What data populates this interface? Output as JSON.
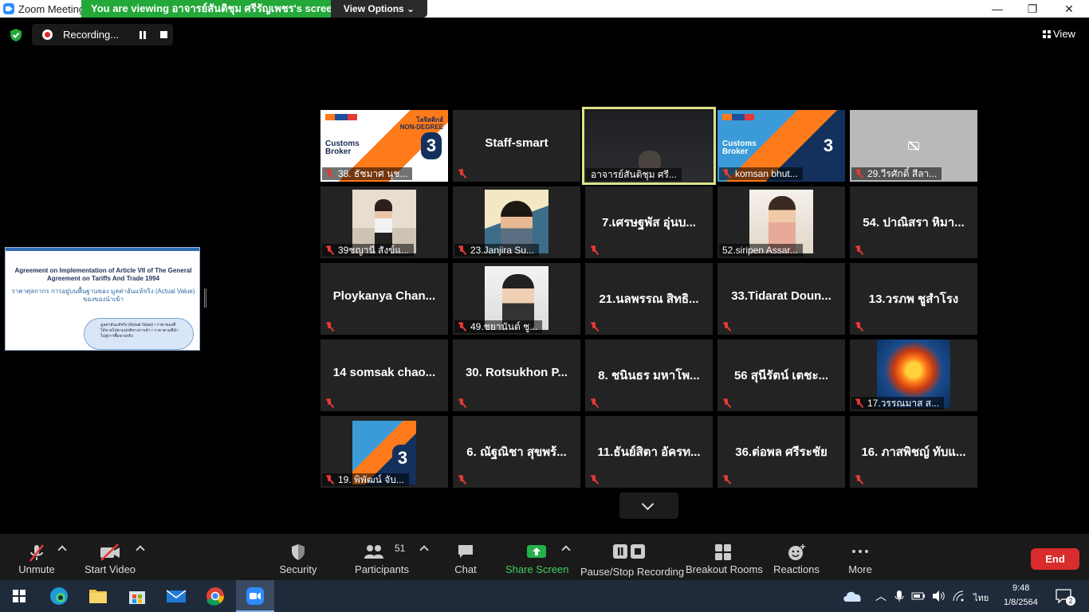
{
  "window": {
    "title": "Zoom Meeting",
    "viewing_banner": "You are viewing อาจารย์สันติชุม ศรีรัญเพชร's screen",
    "view_options_label": "View Options ⌄",
    "minimize": "—",
    "restore": "❐",
    "close": "✕"
  },
  "recording": {
    "label": "Recording..."
  },
  "view_label": "View",
  "shared_screen": {
    "line1": "Agreement on Implementation of Article VII of The General Agreement on Tariffs And Trade 1994",
    "line2": "ราคาศุลกากร การอยู่บนพื้นฐานของ มูลค่าอันแท้จริง (Actual Value) ของของนำเข้า",
    "cloud_text": "มูลค่าอันแท้จริง (Actual Value) • ราคาของที่ได้ขายไปตามปกติทางการค้า • ราคาตามที่นำไปสู่การซื้อขายจริง"
  },
  "poster": {
    "title_line1": "Customs",
    "title_line2": "Broker",
    "number": "3",
    "right_line1": "โลจิสติกส์",
    "right_line2": "NON-DEGREE"
  },
  "tiles": [
    {
      "id": "t1",
      "caption": "38. ธัชมาศ นุช...",
      "name": ""
    },
    {
      "id": "t2",
      "caption": "",
      "name": "Staff-smart"
    },
    {
      "id": "t3",
      "caption": "อาจารย์สันติชุม ศรี...",
      "name": ""
    },
    {
      "id": "t4",
      "caption": "komsan bhut...",
      "name": ""
    },
    {
      "id": "t5",
      "caption": "29.วีรศักดิ์ สีลา...",
      "name": ""
    },
    {
      "id": "t6",
      "caption": "39ชญานี สังข์แ...",
      "name": ""
    },
    {
      "id": "t7",
      "caption": "23.Janjira Su...",
      "name": ""
    },
    {
      "id": "t8",
      "caption": "",
      "name": "7.เศรษฐพัส อุ่นบ..."
    },
    {
      "id": "t9",
      "caption": "52.siripen Assar...",
      "name": ""
    },
    {
      "id": "t10",
      "caption": "",
      "name": "54. ปาณิสรา หิมา..."
    },
    {
      "id": "t11",
      "caption": "",
      "name": "Ploykanya Chan..."
    },
    {
      "id": "t12",
      "caption": "49.ชยานันต์ ชู...",
      "name": ""
    },
    {
      "id": "t13",
      "caption": "",
      "name": "21.นลพรรณ สิทธิ..."
    },
    {
      "id": "t14",
      "caption": "",
      "name": "33.Tidarat Doun..."
    },
    {
      "id": "t15",
      "caption": "",
      "name": "13.วรภพ ชูสำโรง"
    },
    {
      "id": "t16",
      "caption": "",
      "name": "14 somsak chao..."
    },
    {
      "id": "t17",
      "caption": "",
      "name": "30. Rotsukhon P..."
    },
    {
      "id": "t18",
      "caption": "",
      "name": "8. ชนินธร มหาโพ..."
    },
    {
      "id": "t19",
      "caption": "",
      "name": "56 สุนีรัตน์ เตชะ..."
    },
    {
      "id": "t20",
      "caption": "17.วรรณมาส ส...",
      "name": ""
    },
    {
      "id": "t21",
      "caption": "19. พิพัฒน์ จับ...",
      "name": ""
    },
    {
      "id": "t22",
      "caption": "",
      "name": "6. ณัฐณิชา สุขพร้..."
    },
    {
      "id": "t23",
      "caption": "",
      "name": "11.ธันย์สิตา อัครท..."
    },
    {
      "id": "t24",
      "caption": "",
      "name": "36.ต่อพล ศรีระชัย"
    },
    {
      "id": "t25",
      "caption": "",
      "name": "16. ภาสพิชญ์ ทับแ..."
    }
  ],
  "toolbar": {
    "unmute": "Unmute",
    "start_video": "Start Video",
    "security": "Security",
    "participants": "Participants",
    "participants_count": "51",
    "chat": "Chat",
    "share_screen": "Share Screen",
    "pause_stop_recording": "Pause/Stop Recording",
    "breakout_rooms": "Breakout Rooms",
    "reactions": "Reactions",
    "more": "More",
    "end": "End"
  },
  "taskbar": {
    "language": "ไทย",
    "time": "9:48",
    "date": "1/8/2564",
    "notifications": "2"
  },
  "colors": {
    "banner_green": "#23a83a",
    "share_green": "#22b14c",
    "end_red": "#d92c2c",
    "active_speaker_border": "#dfe287",
    "muted_red": "#e53935"
  }
}
